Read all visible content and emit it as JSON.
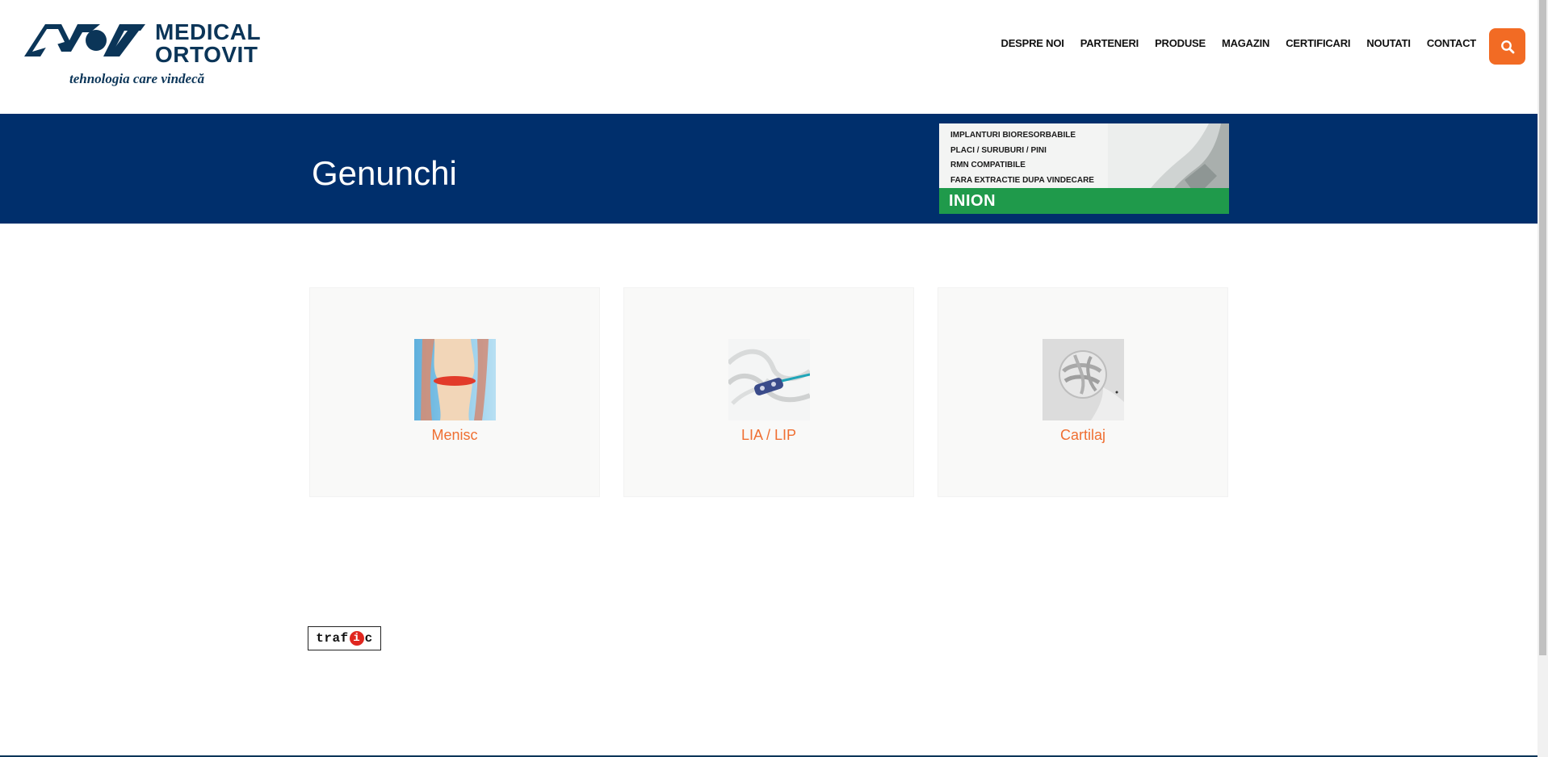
{
  "brand": {
    "name_line1": "MEDICAL",
    "name_line2": "ORTOVIT",
    "tagline": "tehnologia care vindecă",
    "color": "#0b3558"
  },
  "nav": {
    "items": [
      {
        "label": "DESPRE NOI"
      },
      {
        "label": "PARTENERI"
      },
      {
        "label": "PRODUSE"
      },
      {
        "label": "MAGAZIN"
      },
      {
        "label": "CERTIFICARI"
      },
      {
        "label": "NOUTATI"
      },
      {
        "label": "CONTACT"
      }
    ],
    "search_icon": "search-icon",
    "accent_color": "#f26b24"
  },
  "band": {
    "title": "Genunchi",
    "background": "#002f6c"
  },
  "ad": {
    "lines": [
      "IMPLANTURI BIORESORBABILE",
      "PLACI / SURUBURI / PINI",
      "RMN COMPATIBILE",
      "FARA EXTRACTIE DUPA VINDECARE"
    ],
    "brand": "INION",
    "strip_color": "#1f9a4b"
  },
  "cards": [
    {
      "label": "Menisc",
      "image": "knee-image"
    },
    {
      "label": "LIA / LIP",
      "image": "ligament-implant-image"
    },
    {
      "label": "Cartilaj",
      "image": "cartilage-scaffold-image"
    }
  ],
  "counter": {
    "text_before": "traf",
    "text_dot": "i",
    "text_after": "c"
  }
}
